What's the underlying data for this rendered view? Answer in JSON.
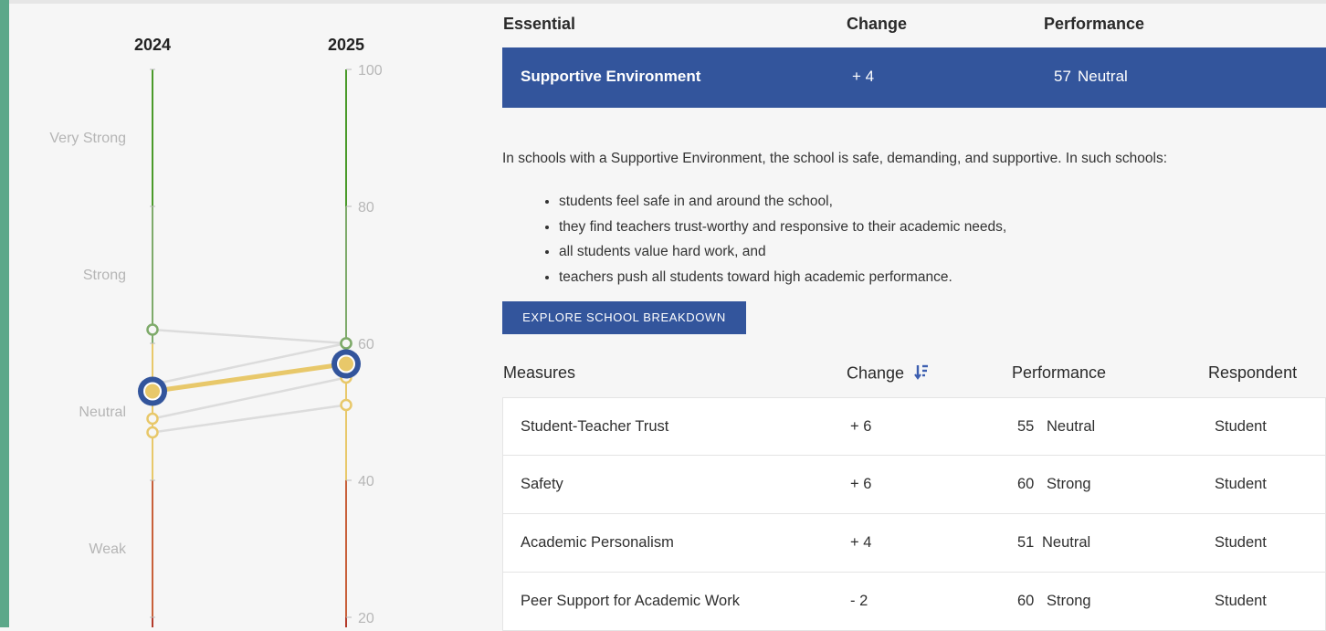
{
  "chart": {
    "year_left": "2024",
    "year_right": "2025",
    "axis_ticks": [
      "100",
      "80",
      "60",
      "40",
      "20"
    ],
    "zone_labels": [
      "Very Strong",
      "Strong",
      "Neutral",
      "Weak"
    ],
    "colors": {
      "very_strong": "#4a9a2a",
      "strong": "#7eaa6a",
      "neutral": "#e8c86a",
      "weak": "#c8603a",
      "very_weak": "#b33a2a",
      "highlight": "#33559c"
    }
  },
  "chart_data": {
    "type": "line",
    "x": [
      "2024",
      "2025"
    ],
    "ylim": [
      0,
      100
    ],
    "series": [
      {
        "values": [
          53,
          57
        ]
      },
      {
        "values": [
          62,
          60
        ]
      },
      {
        "values": [
          54,
          60
        ]
      },
      {
        "values": [
          49,
          55
        ]
      },
      {
        "values": [
          47,
          51
        ]
      }
    ]
  },
  "essential": {
    "header_label": "Essential",
    "header_change": "Change",
    "header_performance": "Performance",
    "name": "Supportive Environment",
    "change": "+ 4",
    "score": "57",
    "rating": "Neutral"
  },
  "description": "In schools with a Supportive Environment, the school is safe, demanding, and supportive. In such schools:",
  "bullets": [
    "students feel safe in and around the school,",
    "they find teachers trust-worthy and responsive to their academic needs,",
    "all students value hard work, and",
    "teachers push all students toward high academic performance."
  ],
  "explore_button": "EXPLORE SCHOOL BREAKDOWN",
  "measures": {
    "header_measures": "Measures",
    "header_change": "Change",
    "header_performance": "Performance",
    "header_respondent": "Respondent",
    "rows": [
      {
        "name": "Student-Teacher Trust",
        "change": "+ 6",
        "score": "55",
        "rating": "Neutral",
        "respondent": "Student"
      },
      {
        "name": "Safety",
        "change": "+ 6",
        "score": "60",
        "rating": "Strong",
        "respondent": "Student"
      },
      {
        "name": "Academic Personalism",
        "change": "+ 4",
        "score": "51",
        "rating": "Neutral",
        "respondent": "Student"
      },
      {
        "name": "Peer Support for Academic Work",
        "change": "- 2",
        "score": "60",
        "rating": "Strong",
        "respondent": "Student"
      }
    ]
  },
  "icons": {
    "sort": "sort-descending-icon"
  }
}
